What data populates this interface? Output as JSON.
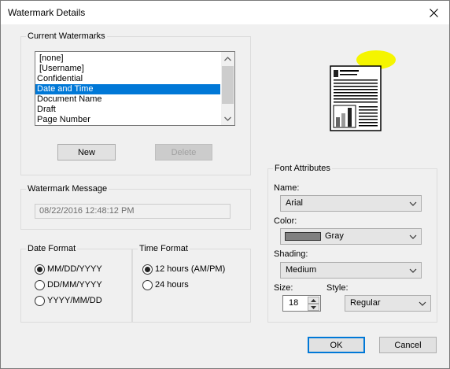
{
  "window": {
    "title": "Watermark Details",
    "close_icon": "close-icon"
  },
  "current_watermarks": {
    "label": "Current Watermarks",
    "items": [
      {
        "label": "[none]",
        "selected": false
      },
      {
        "label": "[Username]",
        "selected": false
      },
      {
        "label": "Confidential",
        "selected": false
      },
      {
        "label": "Date and Time",
        "selected": true
      },
      {
        "label": "Document Name",
        "selected": false
      },
      {
        "label": "Draft",
        "selected": false
      },
      {
        "label": "Page Number",
        "selected": false
      }
    ],
    "new_label": "New",
    "delete_label": "Delete"
  },
  "watermark_message": {
    "label": "Watermark Message",
    "value": "08/22/2016 12:48:12 PM"
  },
  "date_format": {
    "label": "Date Format",
    "options": [
      {
        "label": "MM/DD/YYYY",
        "checked": true
      },
      {
        "label": "DD/MM/YYYY",
        "checked": false
      },
      {
        "label": "YYYY/MM/DD",
        "checked": false
      }
    ]
  },
  "time_format": {
    "label": "Time Format",
    "options": [
      {
        "label": "12 hours (AM/PM)",
        "checked": true
      },
      {
        "label": "24 hours",
        "checked": false
      }
    ]
  },
  "font_attributes": {
    "label": "Font Attributes",
    "name_label": "Name:",
    "name_value": "Arial",
    "color_label": "Color:",
    "color_value": "Gray",
    "color_swatch": "#808080",
    "shading_label": "Shading:",
    "shading_value": "Medium",
    "size_label": "Size:",
    "size_value": "18",
    "style_label": "Style:",
    "style_value": "Regular"
  },
  "preview": {
    "icon": "document-preview-icon",
    "highlight_color": "#f5f500"
  },
  "footer": {
    "ok_label": "OK",
    "cancel_label": "Cancel"
  },
  "colors": {
    "selection": "#0078d7",
    "dialog_bg": "#f0f0f0"
  }
}
